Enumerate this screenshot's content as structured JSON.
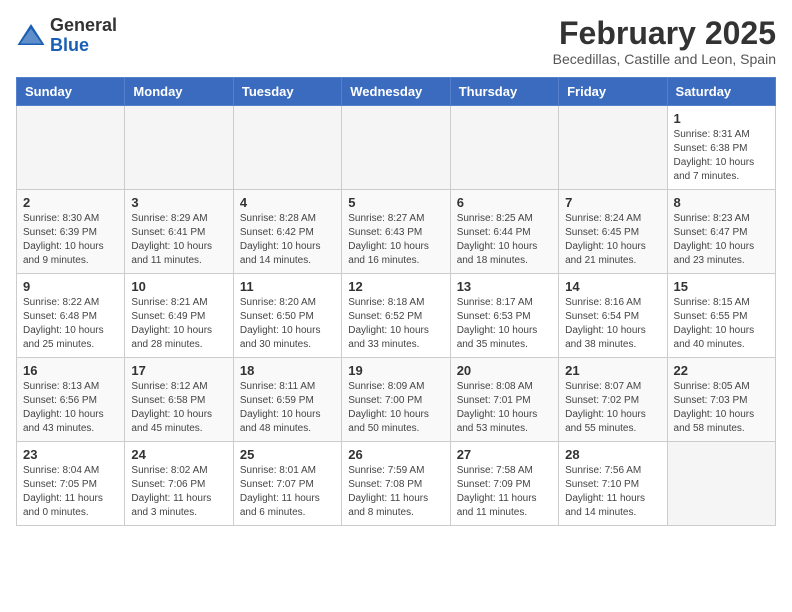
{
  "header": {
    "logo_general": "General",
    "logo_blue": "Blue",
    "month_year": "February 2025",
    "location": "Becedillas, Castille and Leon, Spain"
  },
  "weekdays": [
    "Sunday",
    "Monday",
    "Tuesday",
    "Wednesday",
    "Thursday",
    "Friday",
    "Saturday"
  ],
  "weeks": [
    [
      {
        "day": null,
        "info": null
      },
      {
        "day": null,
        "info": null
      },
      {
        "day": null,
        "info": null
      },
      {
        "day": null,
        "info": null
      },
      {
        "day": null,
        "info": null
      },
      {
        "day": null,
        "info": null
      },
      {
        "day": "1",
        "info": "Sunrise: 8:31 AM\nSunset: 6:38 PM\nDaylight: 10 hours and 7 minutes."
      }
    ],
    [
      {
        "day": "2",
        "info": "Sunrise: 8:30 AM\nSunset: 6:39 PM\nDaylight: 10 hours and 9 minutes."
      },
      {
        "day": "3",
        "info": "Sunrise: 8:29 AM\nSunset: 6:41 PM\nDaylight: 10 hours and 11 minutes."
      },
      {
        "day": "4",
        "info": "Sunrise: 8:28 AM\nSunset: 6:42 PM\nDaylight: 10 hours and 14 minutes."
      },
      {
        "day": "5",
        "info": "Sunrise: 8:27 AM\nSunset: 6:43 PM\nDaylight: 10 hours and 16 minutes."
      },
      {
        "day": "6",
        "info": "Sunrise: 8:25 AM\nSunset: 6:44 PM\nDaylight: 10 hours and 18 minutes."
      },
      {
        "day": "7",
        "info": "Sunrise: 8:24 AM\nSunset: 6:45 PM\nDaylight: 10 hours and 21 minutes."
      },
      {
        "day": "8",
        "info": "Sunrise: 8:23 AM\nSunset: 6:47 PM\nDaylight: 10 hours and 23 minutes."
      }
    ],
    [
      {
        "day": "9",
        "info": "Sunrise: 8:22 AM\nSunset: 6:48 PM\nDaylight: 10 hours and 25 minutes."
      },
      {
        "day": "10",
        "info": "Sunrise: 8:21 AM\nSunset: 6:49 PM\nDaylight: 10 hours and 28 minutes."
      },
      {
        "day": "11",
        "info": "Sunrise: 8:20 AM\nSunset: 6:50 PM\nDaylight: 10 hours and 30 minutes."
      },
      {
        "day": "12",
        "info": "Sunrise: 8:18 AM\nSunset: 6:52 PM\nDaylight: 10 hours and 33 minutes."
      },
      {
        "day": "13",
        "info": "Sunrise: 8:17 AM\nSunset: 6:53 PM\nDaylight: 10 hours and 35 minutes."
      },
      {
        "day": "14",
        "info": "Sunrise: 8:16 AM\nSunset: 6:54 PM\nDaylight: 10 hours and 38 minutes."
      },
      {
        "day": "15",
        "info": "Sunrise: 8:15 AM\nSunset: 6:55 PM\nDaylight: 10 hours and 40 minutes."
      }
    ],
    [
      {
        "day": "16",
        "info": "Sunrise: 8:13 AM\nSunset: 6:56 PM\nDaylight: 10 hours and 43 minutes."
      },
      {
        "day": "17",
        "info": "Sunrise: 8:12 AM\nSunset: 6:58 PM\nDaylight: 10 hours and 45 minutes."
      },
      {
        "day": "18",
        "info": "Sunrise: 8:11 AM\nSunset: 6:59 PM\nDaylight: 10 hours and 48 minutes."
      },
      {
        "day": "19",
        "info": "Sunrise: 8:09 AM\nSunset: 7:00 PM\nDaylight: 10 hours and 50 minutes."
      },
      {
        "day": "20",
        "info": "Sunrise: 8:08 AM\nSunset: 7:01 PM\nDaylight: 10 hours and 53 minutes."
      },
      {
        "day": "21",
        "info": "Sunrise: 8:07 AM\nSunset: 7:02 PM\nDaylight: 10 hours and 55 minutes."
      },
      {
        "day": "22",
        "info": "Sunrise: 8:05 AM\nSunset: 7:03 PM\nDaylight: 10 hours and 58 minutes."
      }
    ],
    [
      {
        "day": "23",
        "info": "Sunrise: 8:04 AM\nSunset: 7:05 PM\nDaylight: 11 hours and 0 minutes."
      },
      {
        "day": "24",
        "info": "Sunrise: 8:02 AM\nSunset: 7:06 PM\nDaylight: 11 hours and 3 minutes."
      },
      {
        "day": "25",
        "info": "Sunrise: 8:01 AM\nSunset: 7:07 PM\nDaylight: 11 hours and 6 minutes."
      },
      {
        "day": "26",
        "info": "Sunrise: 7:59 AM\nSunset: 7:08 PM\nDaylight: 11 hours and 8 minutes."
      },
      {
        "day": "27",
        "info": "Sunrise: 7:58 AM\nSunset: 7:09 PM\nDaylight: 11 hours and 11 minutes."
      },
      {
        "day": "28",
        "info": "Sunrise: 7:56 AM\nSunset: 7:10 PM\nDaylight: 11 hours and 14 minutes."
      },
      {
        "day": null,
        "info": null
      }
    ]
  ]
}
